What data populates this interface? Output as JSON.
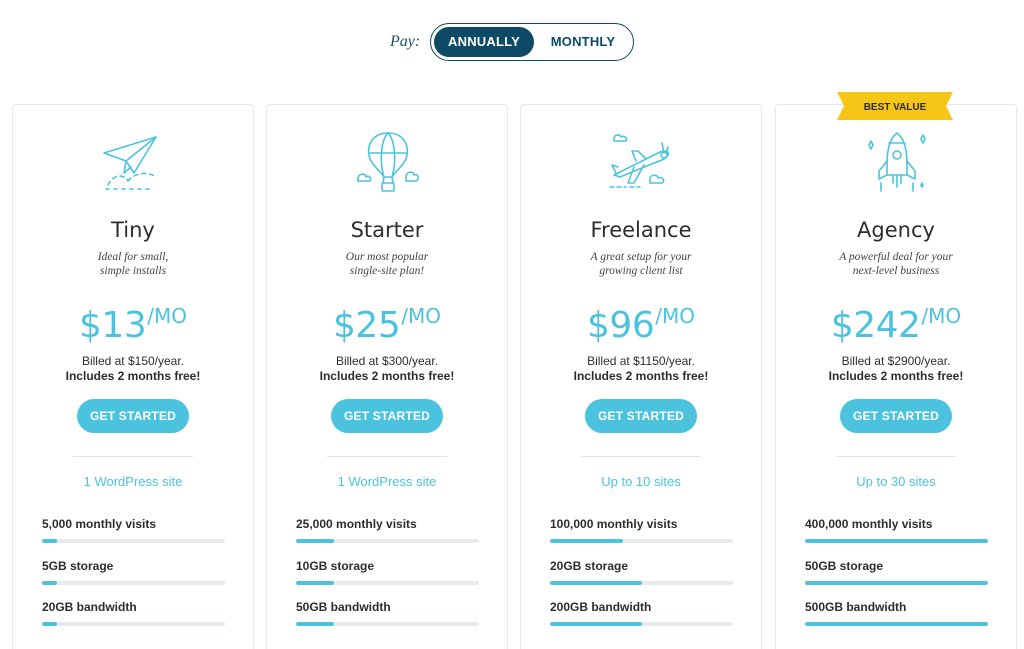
{
  "billing": {
    "pay_label": "Pay:",
    "options": [
      "ANNUALLY",
      "MONTHLY"
    ],
    "selected": "ANNUALLY"
  },
  "colors": {
    "accent": "#4cc3de",
    "navy": "#0c4a66",
    "ribbon": "#f5c518"
  },
  "plans": [
    {
      "icon": "paper-plane-icon",
      "name": "Tiny",
      "desc": "Ideal for small,\nsimple installs",
      "price": "$13",
      "per": "/MO",
      "billed": "Billed at $150/year.",
      "free": "Includes 2 months free!",
      "cta": "GET STARTED",
      "sites": "1 WordPress site",
      "features": [
        {
          "label": "5,000 monthly visits",
          "level": 0.08
        },
        {
          "label": "5GB storage",
          "level": 0.08
        },
        {
          "label": "20GB bandwidth",
          "level": 0.08
        }
      ]
    },
    {
      "icon": "hot-air-balloon-icon",
      "name": "Starter",
      "desc": "Our most popular\nsingle-site plan!",
      "price": "$25",
      "per": "/MO",
      "billed": "Billed at $300/year.",
      "free": "Includes 2 months free!",
      "cta": "GET STARTED",
      "sites": "1 WordPress site",
      "features": [
        {
          "label": "25,000 monthly visits",
          "level": 0.21
        },
        {
          "label": "10GB storage",
          "level": 0.21
        },
        {
          "label": "50GB bandwidth",
          "level": 0.21
        }
      ]
    },
    {
      "icon": "airplane-icon",
      "name": "Freelance",
      "desc": "A great setup for your\ngrowing client list",
      "price": "$96",
      "per": "/MO",
      "billed": "Billed at $1150/year.",
      "free": "Includes 2 months free!",
      "cta": "GET STARTED",
      "sites": "Up to 10 sites",
      "features": [
        {
          "label": "100,000 monthly visits",
          "level": 0.4
        },
        {
          "label": "20GB storage",
          "level": 0.5
        },
        {
          "label": "200GB bandwidth",
          "level": 0.5
        }
      ]
    },
    {
      "icon": "rocket-icon",
      "name": "Agency",
      "desc": "A powerful deal for your\nnext-level business",
      "price": "$242",
      "per": "/MO",
      "billed": "Billed at $2900/year.",
      "free": "Includes 2 months free!",
      "cta": "GET STARTED",
      "sites": "Up to 30 sites",
      "ribbon": "BEST VALUE",
      "features": [
        {
          "label": "400,000 monthly visits",
          "level": 1.0
        },
        {
          "label": "50GB storage",
          "level": 1.0
        },
        {
          "label": "500GB bandwidth",
          "level": 1.0
        }
      ]
    }
  ]
}
